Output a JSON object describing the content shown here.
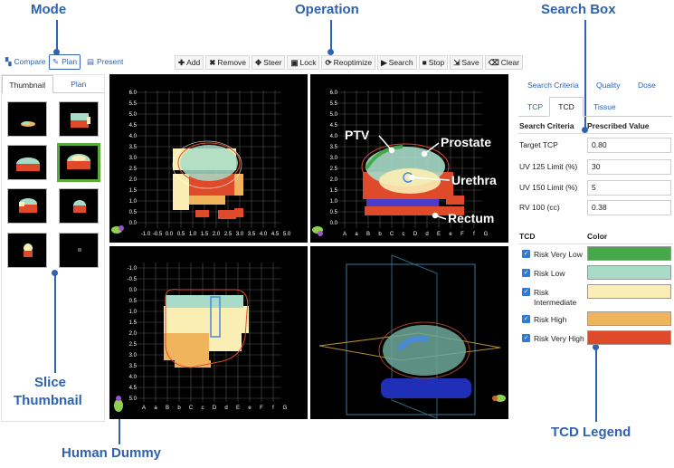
{
  "annotations": {
    "mode": "Mode",
    "operation": "Operation",
    "search_box": "Search Box",
    "slice_thumbnail_line1": "Slice",
    "slice_thumbnail_line2": "Thumbnail",
    "human_dummy": "Human Dummy",
    "tcd_legend": "TCD Legend"
  },
  "mode_buttons": [
    {
      "label": "Compare",
      "icon": "compare-icon",
      "active": false
    },
    {
      "label": "Plan",
      "icon": "pencil-icon",
      "active": true
    },
    {
      "label": "Present",
      "icon": "present-icon",
      "active": false
    }
  ],
  "toolbar": [
    {
      "label": "Add",
      "icon": "plus-icon",
      "glyph": "✚"
    },
    {
      "label": "Remove",
      "icon": "x-icon",
      "glyph": "✖"
    },
    {
      "label": "Steer",
      "icon": "move-icon",
      "glyph": "✥"
    },
    {
      "label": "Lock",
      "icon": "lock-icon",
      "glyph": "🔒"
    },
    {
      "label": "Reoptimize",
      "icon": "refresh-icon",
      "glyph": "⟳"
    },
    {
      "label": "Search",
      "icon": "play-icon",
      "glyph": "▶"
    },
    {
      "label": "Stop",
      "icon": "stop-icon",
      "glyph": "■"
    },
    {
      "label": "Save",
      "icon": "save-icon",
      "glyph": "⇲"
    },
    {
      "label": "Clear",
      "icon": "trash-icon",
      "glyph": "🗑"
    }
  ],
  "thumbnail_panel": {
    "tabs": [
      "Thumbnail",
      "Plan"
    ],
    "active_tab": "Thumbnail",
    "selected_index": 3
  },
  "viewports": {
    "top_left": {
      "y_ticks": [
        "6.0",
        "5.5",
        "5.0",
        "4.5",
        "4.0",
        "3.5",
        "3.0",
        "2.5",
        "2.0",
        "1.5",
        "1.0",
        "0.5",
        "0.0"
      ],
      "x_ticks": [
        "-1.0",
        "-0.5",
        "0.0",
        "0.5",
        "1.0",
        "1.5",
        "2.0",
        "2.5",
        "3.0",
        "3.5",
        "4.0",
        "4.5",
        "5.0"
      ]
    },
    "top_right": {
      "y_ticks": [
        "6.0",
        "5.5",
        "5.0",
        "4.5",
        "4.0",
        "3.5",
        "3.0",
        "2.5",
        "2.0",
        "1.5",
        "1.0",
        "0.5",
        "0.0"
      ],
      "x_ticks": [
        "A",
        "a",
        "B",
        "b",
        "C",
        "c",
        "D",
        "d",
        "E",
        "e",
        "F",
        "f",
        "G"
      ],
      "labels": {
        "ptv": "PTV",
        "prostate": "Prostate",
        "urethra": "Urethra",
        "rectum": "Rectum"
      }
    },
    "bottom_left": {
      "y_ticks": [
        "-1.0",
        "-0.5",
        "0.0",
        "0.5",
        "1.0",
        "1.5",
        "2.0",
        "2.5",
        "3.0",
        "3.5",
        "4.0",
        "4.5",
        "5.0"
      ],
      "x_ticks": [
        "A",
        "a",
        "B",
        "b",
        "C",
        "c",
        "D",
        "d",
        "E",
        "e",
        "F",
        "f",
        "G"
      ]
    }
  },
  "right_panel": {
    "tabs_row1": [
      "Search Criteria",
      "Quality",
      "Dose"
    ],
    "tabs_row2": [
      "TCP",
      "TCD",
      "Tissue"
    ],
    "active_tab_row2": "TCD",
    "criteria_header": {
      "name": "Search Criteria",
      "value": "Prescribed Value"
    },
    "criteria": [
      {
        "name": "Target TCP",
        "value": "0.80"
      },
      {
        "name": "UV 125 Limit (%)",
        "value": "30"
      },
      {
        "name": "UV 150 Limit (%)",
        "value": "5"
      },
      {
        "name": "RV 100 (cc)",
        "value": "0.38"
      }
    ],
    "legend_header": {
      "name": "TCD",
      "color": "Color"
    },
    "legend": [
      {
        "label": "Risk Very Low",
        "color": "#47a84a"
      },
      {
        "label": "Risk Low",
        "color": "#a8dcc8"
      },
      {
        "label": "Risk Intermediate",
        "label_line1": "Risk",
        "label_line2": "Intermediate",
        "color": "#fbeeb4"
      },
      {
        "label": "Risk High",
        "color": "#efb45c"
      },
      {
        "label": "Risk Very High",
        "color": "#df4a2a"
      }
    ]
  }
}
